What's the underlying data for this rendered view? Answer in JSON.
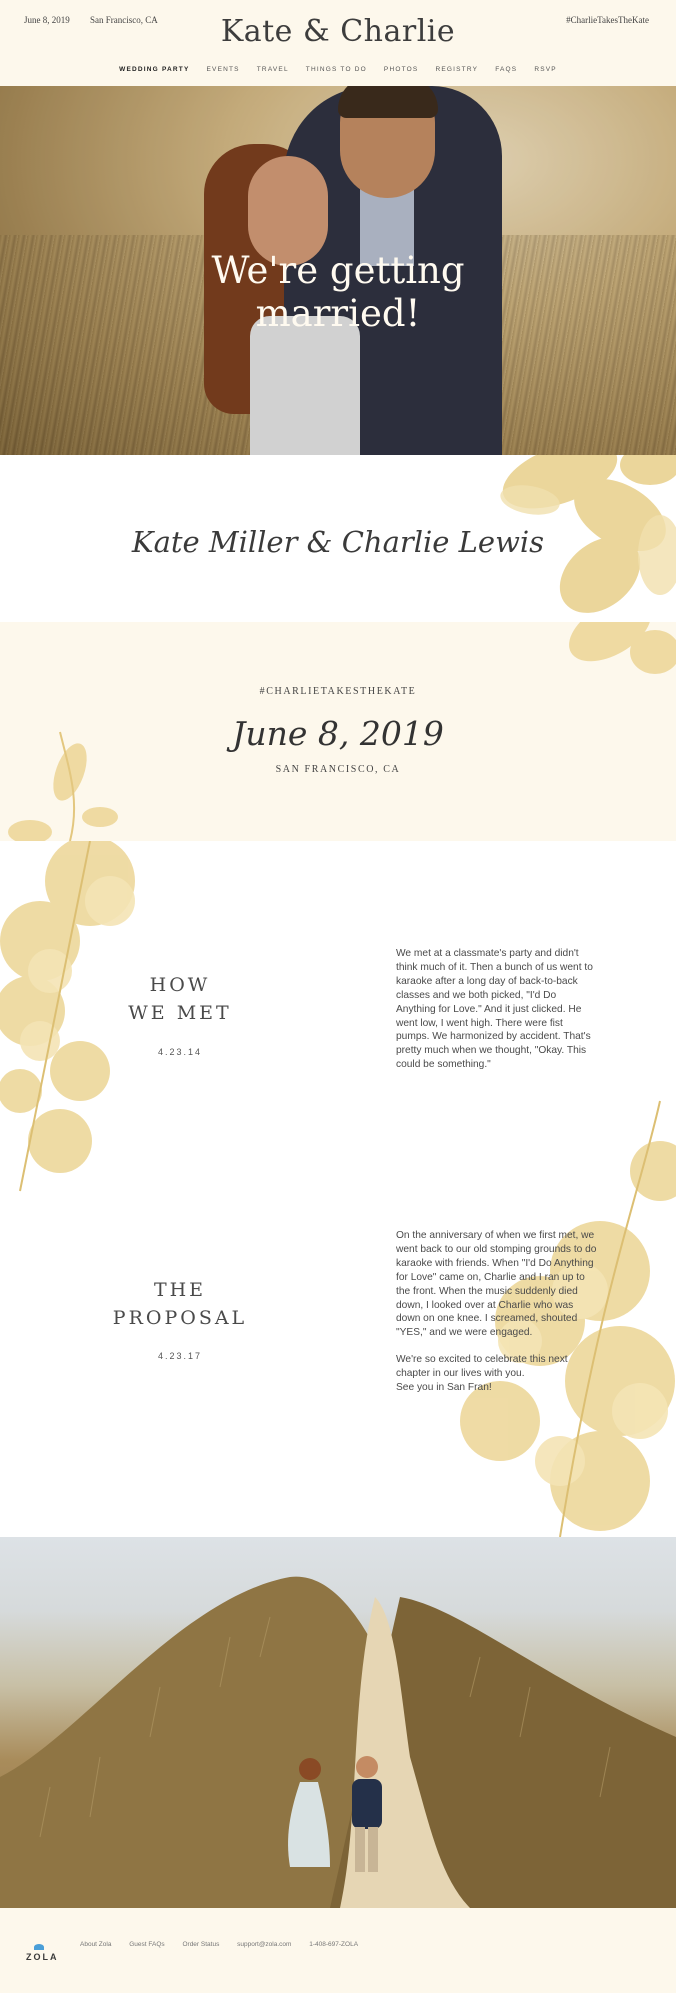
{
  "header": {
    "date": "June 8, 2019",
    "city": "San Francisco, CA",
    "title": "Kate & Charlie",
    "hashtag": "#CharlieTakesTheKate",
    "nav": [
      "WEDDING PARTY",
      "EVENTS",
      "TRAVEL",
      "THINGS TO DO",
      "PHOTOS",
      "REGISTRY",
      "FAQS",
      "RSVP"
    ]
  },
  "hero": {
    "line1": "We're getting",
    "line2": "married!"
  },
  "names": "Kate Miller & Charlie Lewis",
  "date_block": {
    "hashtag": "#CHARLIETAKESTHEKATE",
    "date": "June 8, 2019",
    "city": "SAN FRANCISCO, CA"
  },
  "how_we_met": {
    "title_line1": "HOW",
    "title_line2": "WE MET",
    "date": "4.23.14",
    "body": "We met at a classmate's party and didn't think much of it. Then a bunch of us went to karaoke after a long day of back-to-back classes and we both picked, \"I'd Do Anything for Love.\" And it just clicked. He went low, I went high. There were fist pumps. We harmonized by accident. That's pretty much when we thought, \"Okay. This could be something.\""
  },
  "proposal": {
    "title_line1": "THE",
    "title_line2": "PROPOSAL",
    "date": "4.23.17",
    "body1": "On the anniversary of when we first met, we went back to our old stomping grounds to do karaoke with friends. When \"I'd Do Anything for Love\" came on, Charlie and I ran up to the front. When the music suddenly died down, I looked over at Charlie who was down on one knee. I screamed, shouted \"YES,\" and we were engaged.",
    "body2": "We're so excited to celebrate this next chapter in our lives with you.",
    "body3": "See you in San Fran!"
  },
  "footer": {
    "logo": "ZOLA",
    "links": [
      "About Zola",
      "Guest FAQs",
      "Order Status",
      "support@zola.com",
      "1-408-697-ZOLA"
    ]
  },
  "colors": {
    "background": "#fdf8ec",
    "gold": "#e3c77f",
    "text": "#3b3b3b"
  }
}
